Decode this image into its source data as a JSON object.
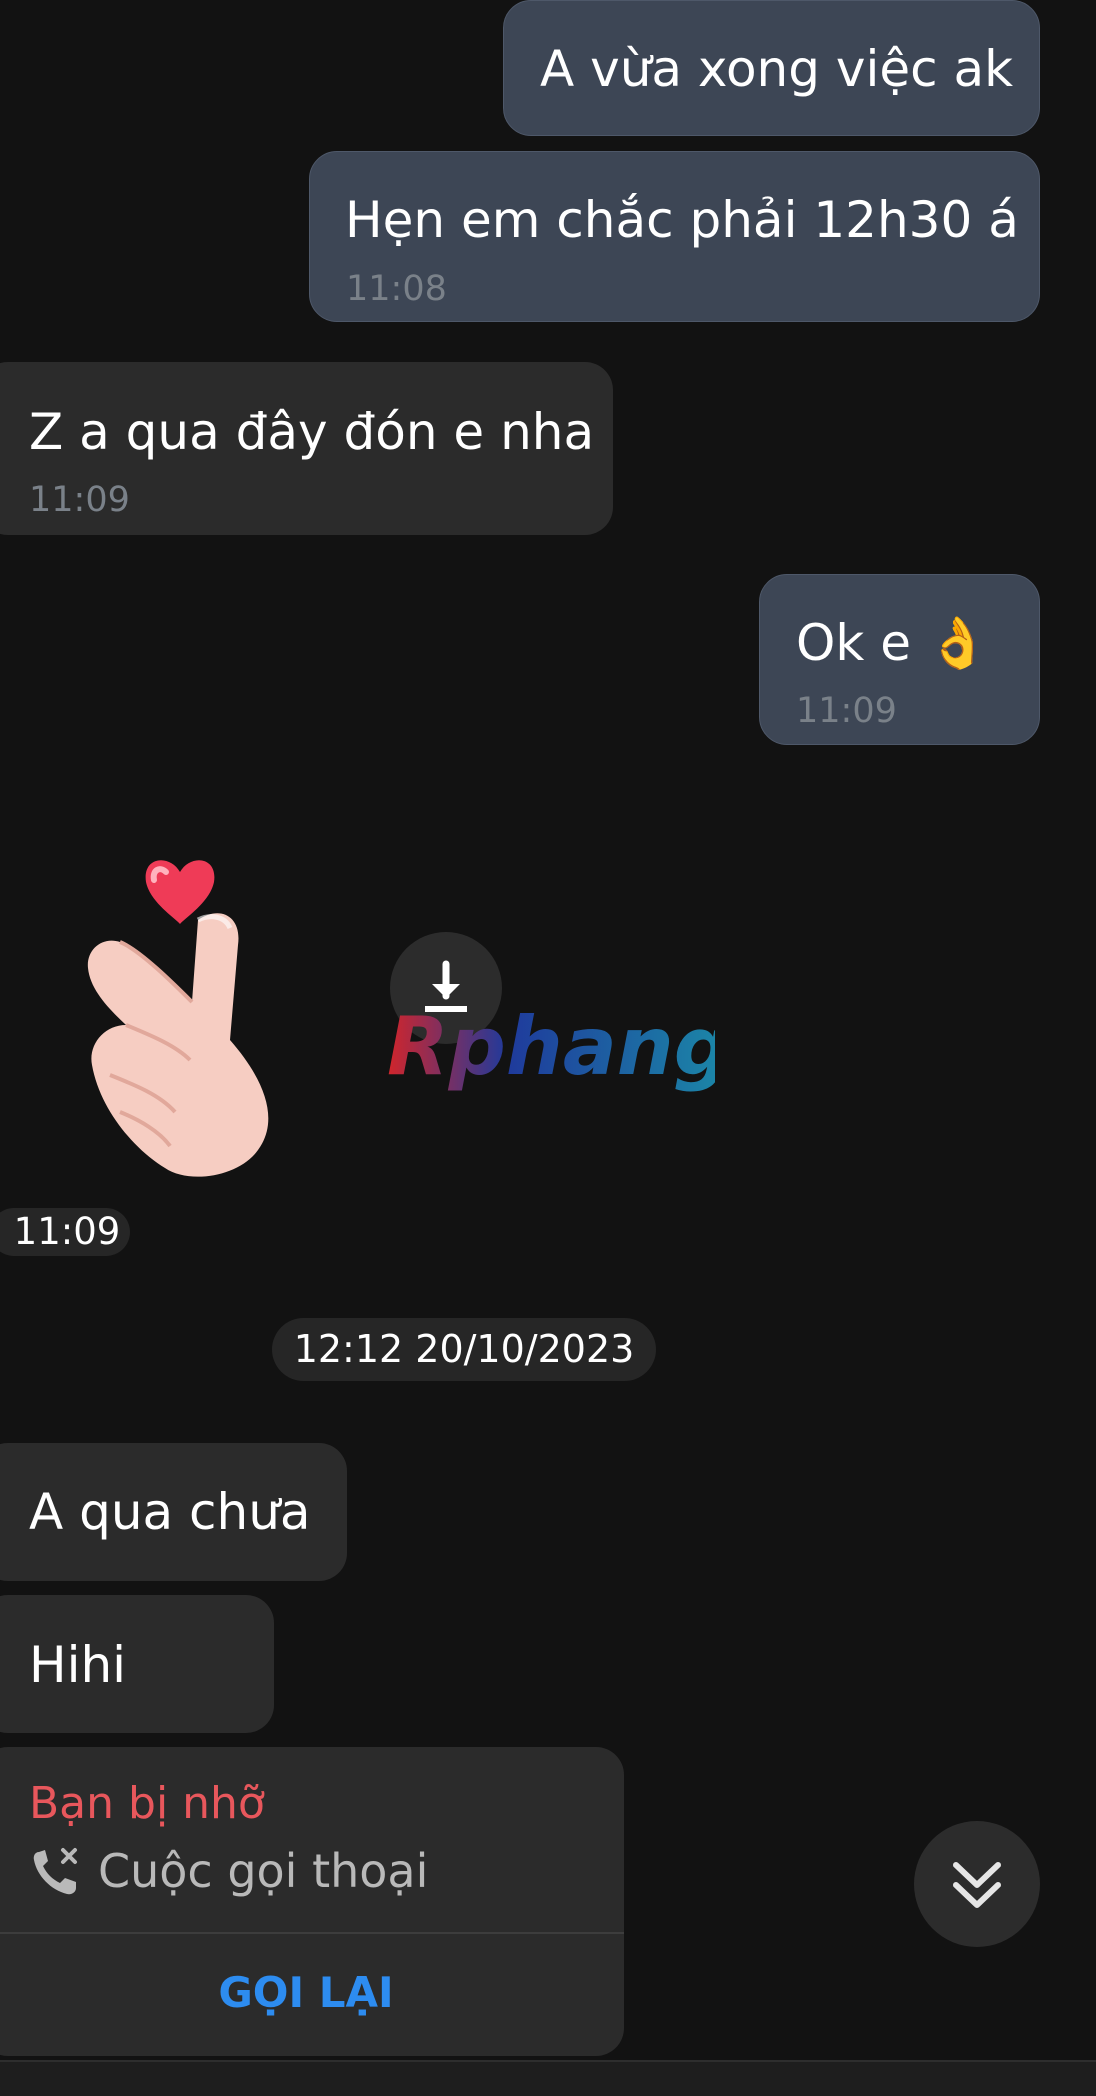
{
  "messages": [
    {
      "text": "A vừa xong việc ak"
    },
    {
      "text": "Hẹn em chắc phải 12h30 á",
      "time": "11:08"
    },
    {
      "text": "Z a qua đây đón e nha",
      "time": "11:09"
    },
    {
      "text": "Ok e 👌",
      "time": "11:09"
    }
  ],
  "sticker": {
    "time": "11:09",
    "watermark": "Rphang"
  },
  "date_separator": "12:12 20/10/2023",
  "messages2": [
    {
      "text": "A qua chưa"
    },
    {
      "text": "Hihi"
    }
  ],
  "missed_call": {
    "title": "Bạn bị nhỡ",
    "subtitle": "Cuộc gọi thoại",
    "action": "GỌI LẠI"
  },
  "colors": {
    "background": "#121212",
    "outgoing_bubble": "#3d4655",
    "incoming_bubble": "#2b2b2b",
    "missed_red": "#e8575c",
    "callback_blue": "#2d8cf0"
  },
  "icons": [
    "download-icon",
    "missed-call-icon",
    "scroll-down-icon"
  ]
}
